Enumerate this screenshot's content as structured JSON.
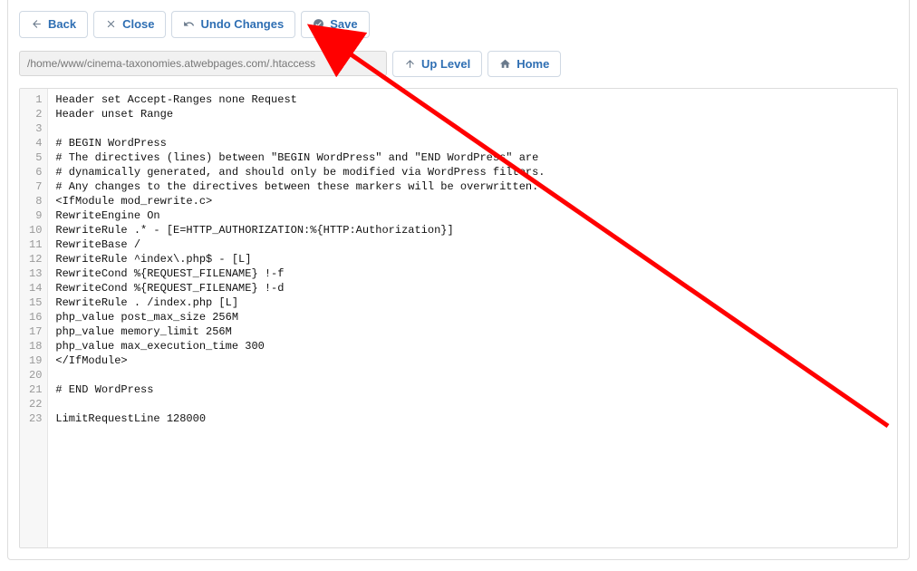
{
  "toolbar": {
    "back": "Back",
    "close": "Close",
    "undo": "Undo Changes",
    "save": "Save"
  },
  "nav": {
    "path": "/home/www/cinema-taxonomies.atwebpages.com/.htaccess",
    "upLevel": "Up Level",
    "home": "Home"
  },
  "editor": {
    "lines": [
      "Header set Accept-Ranges none Request",
      "Header unset Range",
      "",
      "# BEGIN WordPress",
      "# The directives (lines) between \"BEGIN WordPress\" and \"END WordPress\" are",
      "# dynamically generated, and should only be modified via WordPress filters.",
      "# Any changes to the directives between these markers will be overwritten.",
      "<IfModule mod_rewrite.c>",
      "RewriteEngine On",
      "RewriteRule .* - [E=HTTP_AUTHORIZATION:%{HTTP:Authorization}]",
      "RewriteBase /",
      "RewriteRule ^index\\.php$ - [L]",
      "RewriteCond %{REQUEST_FILENAME} !-f",
      "RewriteCond %{REQUEST_FILENAME} !-d",
      "RewriteRule . /index.php [L]",
      "php_value post_max_size 256M",
      "php_value memory_limit 256M",
      "php_value max_execution_time 300",
      "</IfModule>",
      "",
      "# END WordPress",
      "",
      "LimitRequestLine 128000"
    ]
  },
  "annotation_arrow": {
    "color": "#ff0000",
    "description": "Red arrow pointing from bottom-right to Save button"
  }
}
